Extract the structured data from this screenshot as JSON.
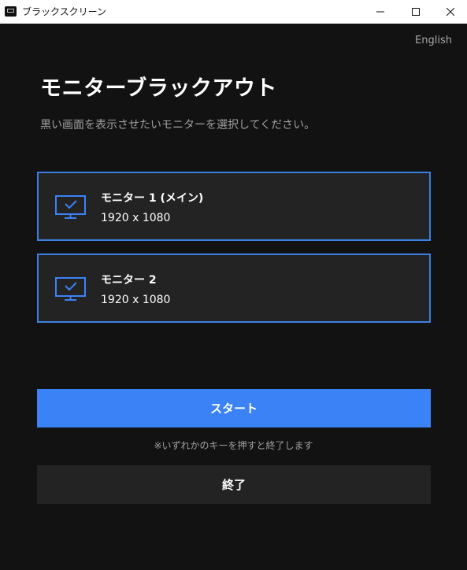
{
  "window": {
    "title": "ブラックスクリーン"
  },
  "language_link": "English",
  "page_title": "モニターブラックアウト",
  "subtitle": "黒い画面を表示させたいモニターを選択してください。",
  "monitors": [
    {
      "name": "モニター 1 (メイン)",
      "resolution": "1920 x 1080",
      "selected": true,
      "icon": "monitor-check-icon"
    },
    {
      "name": "モニター 2",
      "resolution": "1920 x 1080",
      "selected": true,
      "icon": "monitor-check-icon"
    }
  ],
  "start_button_label": "スタート",
  "hint_text": "※いずれかのキーを押すと終了します",
  "exit_button_label": "終了",
  "colors": {
    "background": "#121212",
    "card_background": "#232323",
    "accent": "#3b82f6",
    "card_border": "#3b7fe0",
    "muted_text": "#a0a0a0"
  }
}
